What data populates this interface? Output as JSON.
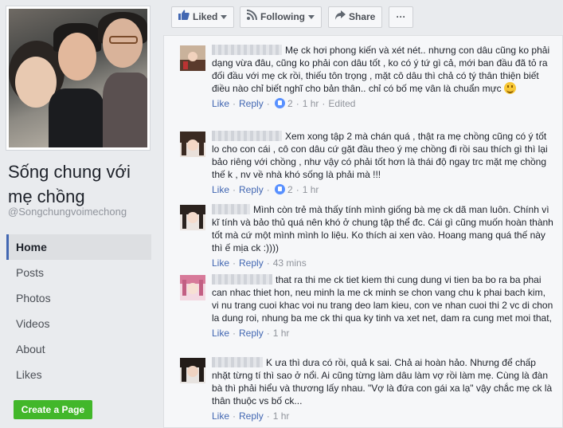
{
  "page": {
    "title": "Sống chung với mẹ chồng",
    "handle": "@Songchungvoimechong"
  },
  "nav": {
    "items": [
      "Home",
      "Posts",
      "Photos",
      "Videos",
      "About",
      "Likes"
    ],
    "active": "Home"
  },
  "create_page_button": "Create a Page",
  "actions": {
    "liked": "Liked",
    "following": "Following",
    "share": "Share",
    "more": "···"
  },
  "colors": {
    "brand_blue": "#4267b2",
    "create_green": "#42b72a"
  },
  "comments": [
    {
      "text": "Mẹ ck hơi phong kiến và xét nét.. nhưng con dâu cũng ko phải dạng vừa đâu, cũng ko phải con dâu tốt , ko có ý tứ gì cả, mới ban đầu đã tỏ ra đối đầu với mẹ ck rồi, thiếu tôn trọng , mặt cô dâu thì chả có tý thân thiện biết điều nào chỉ biết nghĩ cho bản thân.. chỉ có bố mẹ vân là chuẩn mực",
      "like": "Like",
      "reply": "Reply",
      "reactions": "2",
      "time": "1 hr",
      "edited": "Edited"
    },
    {
      "text": "Xem xong tập 2 mà chán quá , thật ra mẹ chồng cũng có ý tốt lo cho con cái , cô con dâu cứ gặt đầu theo ý mẹ chồng đi rồi sau thích gì thì lại bảo riêng với chồng , như vậy có phải tốt hơn là thái độ ngay trc mặt mẹ chồng thế k , nv về nhà khó sống là phải mà !!!",
      "like": "Like",
      "reply": "Reply",
      "reactions": "2",
      "time": "1 hr"
    },
    {
      "text": "Mình còn trẻ mà thấy tính mình giống bà mẹ ck dã man luôn. Chính vì kĩ tính và bảo thủ quá nên khó ở chung tập thể đc. Cái gì cũng muốn hoàn thành tốt mà cứ một mình mình lo liệu. Ko thích ai xen vào. Hoang mang quá thế này thì ế mịa ck :))))",
      "like": "Like",
      "reply": "Reply",
      "time": "43 mins"
    },
    {
      "text": "that ra thi me ck tiet kiem thi cung dung vi tien ba bo ra ba phai can nhac thiet hon, neu minh la me ck minh se chon vang chu k phai bach kim, vi nu trang cuoi khac voi nu trang deo lam kieu, con ve nhan cuoi thi 2 vc di chon la dung roi, nhung ba me ck thi qua ky tinh va xet net, dam ra cung met moi that,",
      "like": "Like",
      "reply": "Reply",
      "time": "1 hr"
    },
    {
      "text": "K ưa thì dưa có rồi, quả k sai. Chả ai hoàn hảo. Nhưng để chấp nhặt từng tí thì sao ở nổi. Ai cũng từng làm dâu làm vợ rồi làm mẹ. Cùng là đàn bà thì phải hiểu và thương lấy nhau. \"Vợ là đứa con gái xa lạ\" vậy chắc mẹ ck là thân thuộc vs bố ck...",
      "like": "Like",
      "reply": "Reply",
      "time": "1 hr"
    }
  ]
}
